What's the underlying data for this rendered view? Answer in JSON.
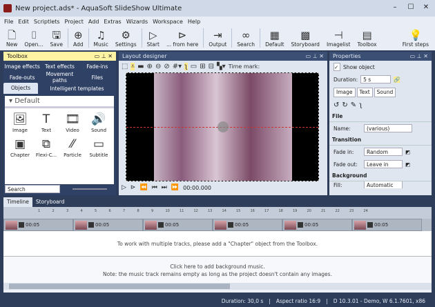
{
  "window": {
    "title": "New project.ads* - AquaSoft SlideShow Ultimate",
    "minimize": "–",
    "maximize": "☐",
    "close": "✕"
  },
  "menu": [
    "File",
    "Edit",
    "Scriptlets",
    "Project",
    "Add",
    "Extras",
    "Wizards",
    "Workspace",
    "Help"
  ],
  "toolbar": [
    {
      "label": "New",
      "icon": "new-file-icon",
      "glyph": "🗋"
    },
    {
      "label": "Open...",
      "icon": "open-icon",
      "glyph": "⌷"
    },
    {
      "label": "Save",
      "icon": "save-icon",
      "glyph": "🖫"
    },
    {
      "label": "Add",
      "icon": "add-circle-icon",
      "glyph": "⊕"
    },
    {
      "label": "Music",
      "icon": "music-icon",
      "glyph": "♫"
    },
    {
      "label": "Settings",
      "icon": "gear-icon",
      "glyph": "⚙"
    },
    {
      "label": "Start",
      "icon": "play-icon",
      "glyph": "▷"
    },
    {
      "label": "... from here",
      "icon": "play-from-here-icon",
      "glyph": "⊳"
    },
    {
      "label": "Output",
      "icon": "output-icon",
      "glyph": "⇥"
    },
    {
      "label": "Search",
      "icon": "binoculars-icon",
      "glyph": "∞"
    },
    {
      "label": "Default",
      "icon": "layout-default-icon",
      "glyph": "▦"
    },
    {
      "label": "Storyboard",
      "icon": "storyboard-icon",
      "glyph": "▩"
    },
    {
      "label": "Imagelist",
      "icon": "imagelist-icon",
      "glyph": "⊣"
    },
    {
      "label": "Toolbox",
      "icon": "toolbox-icon",
      "glyph": "▤"
    },
    {
      "label": "First steps",
      "icon": "lightbulb-icon",
      "glyph": "💡"
    }
  ],
  "toolbox": {
    "title": "Toolbox",
    "tabs_row1": [
      "Image effects",
      "Text effects",
      "Fade-ins"
    ],
    "tabs_row2": [
      "Fade-outs",
      "Movement paths",
      "Files"
    ],
    "tabs_row3": [
      "Objects",
      "Intelligent templates"
    ],
    "group": "Default",
    "objects": [
      {
        "label": "Image",
        "glyph": "🖼"
      },
      {
        "label": "Text",
        "glyph": "T"
      },
      {
        "label": "Video",
        "glyph": "🎞"
      },
      {
        "label": "Sound",
        "glyph": "🔊"
      },
      {
        "label": "Chapter",
        "glyph": "▣"
      },
      {
        "label": "Flexi-C...",
        "glyph": "⧉"
      },
      {
        "label": "Particle",
        "glyph": "⁄⁄"
      },
      {
        "label": "Subtitle",
        "glyph": "▭"
      }
    ],
    "search_placeholder": "Search"
  },
  "layout_designer": {
    "title": "Layout designer",
    "time_mark_label": "Time mark:",
    "time": "00:00.000"
  },
  "properties": {
    "title": "Properties",
    "show_object": "Show object",
    "duration_label": "Duration:",
    "duration_value": "5 s",
    "tabs": [
      "Image",
      "Text",
      "Sound"
    ],
    "file_section": "File",
    "name_label": "Name:",
    "name_value": "(various)",
    "transition_section": "Transition",
    "fade_in_label": "Fade in:",
    "fade_in_value": "Random",
    "fade_out_label": "Fade out:",
    "fade_out_value": "Leave in plac",
    "background_section": "Background",
    "fill_label": "Fill:",
    "fill_value": "Automatic"
  },
  "timeline": {
    "tabs": [
      "Timeline",
      "Storyboard"
    ],
    "ruler": [
      "1",
      "2",
      "3",
      "4",
      "5",
      "6",
      "7",
      "8",
      "9",
      "10",
      "11",
      "12",
      "13",
      "14",
      "15",
      "16",
      "17",
      "18",
      "19",
      "20",
      "21",
      "22",
      "23",
      "24"
    ],
    "clips": [
      "00:05",
      "00:05",
      "00:05",
      "00:05",
      "00:05",
      "00:05"
    ],
    "chapter_hint": "To work with multiple tracks, please add a \"Chapter\" object from the Toolbox.",
    "music_hint1": "Click here to add background music.",
    "music_hint2": "Note: the music track remains empty as long as the project doesn't contain any images."
  },
  "status": {
    "duration": "Duration: 30,0 s",
    "aspect": "Aspect ratio 16:9",
    "version": "D 10.3.01 - Demo, W 6.1.7601, x86"
  }
}
